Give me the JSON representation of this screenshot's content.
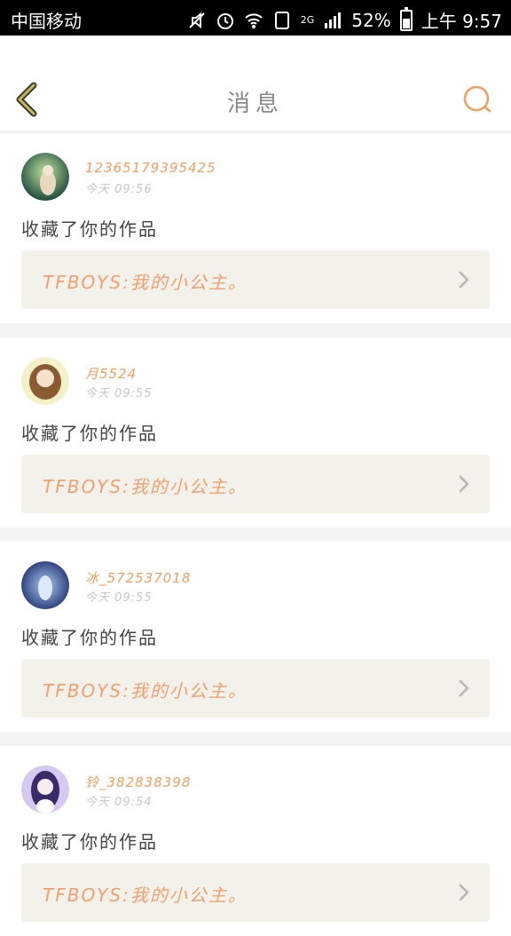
{
  "status_bar": {
    "carrier": "中国移动",
    "network": "2G",
    "battery": "52%",
    "time": "上午 9:57"
  },
  "header": {
    "title": "消息"
  },
  "messages": [
    {
      "username": "12365179395425",
      "time": "今天 09:56",
      "action": "收藏了你的作品",
      "work_title": "TFBOYS:我的小公主。"
    },
    {
      "username": "月5524",
      "time": "今天 09:55",
      "action": "收藏了你的作品",
      "work_title": "TFBOYS:我的小公主。"
    },
    {
      "username": "冰_572537018",
      "time": "今天 09:55",
      "action": "收藏了你的作品",
      "work_title": "TFBOYS:我的小公主。"
    },
    {
      "username": "铃_382838398",
      "time": "今天 09:54",
      "action": "收藏了你的作品",
      "work_title": "TFBOYS:我的小公主。"
    }
  ],
  "colors": {
    "accent": "#f0a060",
    "back_icon": "#c9b84a",
    "work_bg": "#f2f2ea"
  }
}
